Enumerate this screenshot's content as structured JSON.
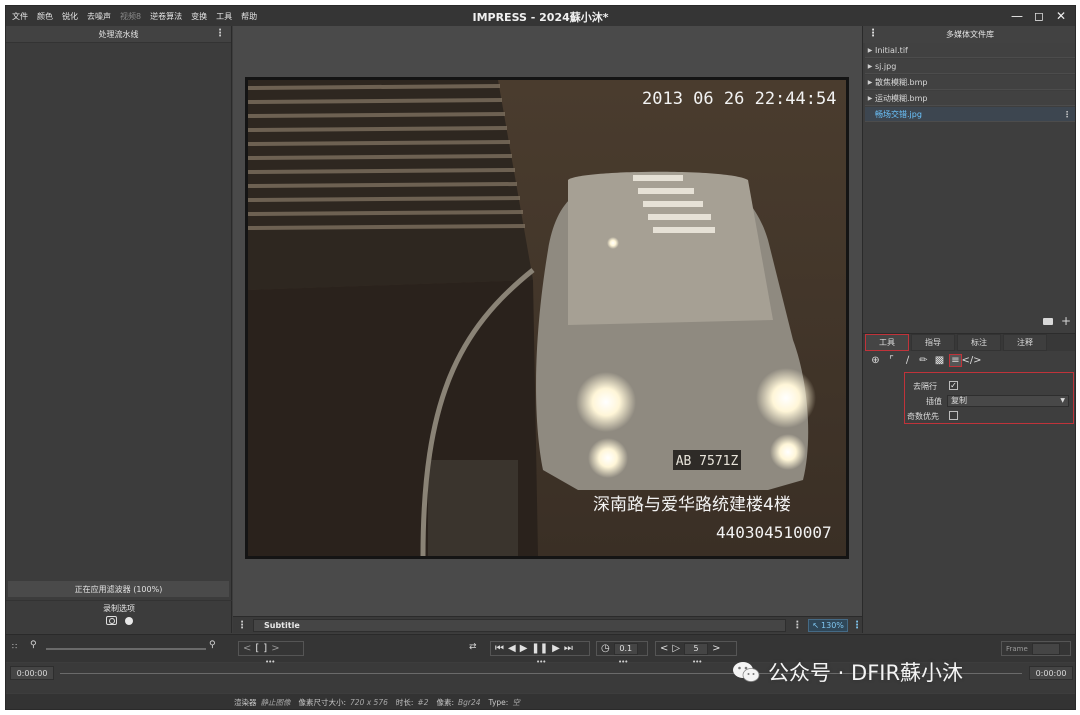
{
  "titlebar": {
    "menu": [
      "文件",
      "颜色",
      "锐化",
      "去噪声",
      "视频8",
      "逆卷算法",
      "变换",
      "工具",
      "帮助"
    ],
    "title": "IMPRESS - 2024蘇小沐*"
  },
  "left_panel": {
    "header": "处理流水线",
    "filter_status": "正在应用滤波器 (100%)",
    "record_header": "录制选项"
  },
  "viewer": {
    "overlay_datetime": "2013 06 26 22:44:54",
    "overlay_location": "深南路与爱华路统建楼4楼",
    "overlay_camera_id": "440304510007",
    "plate": "AB 7571Z",
    "subtitle_label": "Subtitle",
    "zoom": "130%"
  },
  "right_panel": {
    "header": "多媒体文件库",
    "files": [
      {
        "name": "Initial.tif",
        "active": false
      },
      {
        "name": "sj.jpg",
        "active": false
      },
      {
        "name": "散焦模糊.bmp",
        "active": false
      },
      {
        "name": "运动模糊.bmp",
        "active": false
      },
      {
        "name": "畅场交错.jpg",
        "active": true
      }
    ],
    "tabs": [
      "工具",
      "指导",
      "标注",
      "注释"
    ],
    "props": {
      "deinterlace_label": "去隔行",
      "deinterlace_checked": "✓",
      "interp_label": "插值",
      "interp_value": "复制",
      "odd_first_label": "奇数优先"
    }
  },
  "controls": {
    "speed": "0.1",
    "step": "5",
    "frame_label": "Frame",
    "time_start": "0:00:00",
    "time_end": "0:00:00"
  },
  "status": {
    "renderer_label": "渲染器",
    "renderer_value": "静止图像",
    "size_label": "像素尺寸大小:",
    "size_value": "720 x 576",
    "duration_label": "时长:",
    "duration_value": "#2",
    "pixel_label": "像素:",
    "pixel_value": "Bgr24",
    "type_label": "Type:",
    "type_value": "空"
  },
  "watermark": "公众号 · DFIR蘇小沐"
}
